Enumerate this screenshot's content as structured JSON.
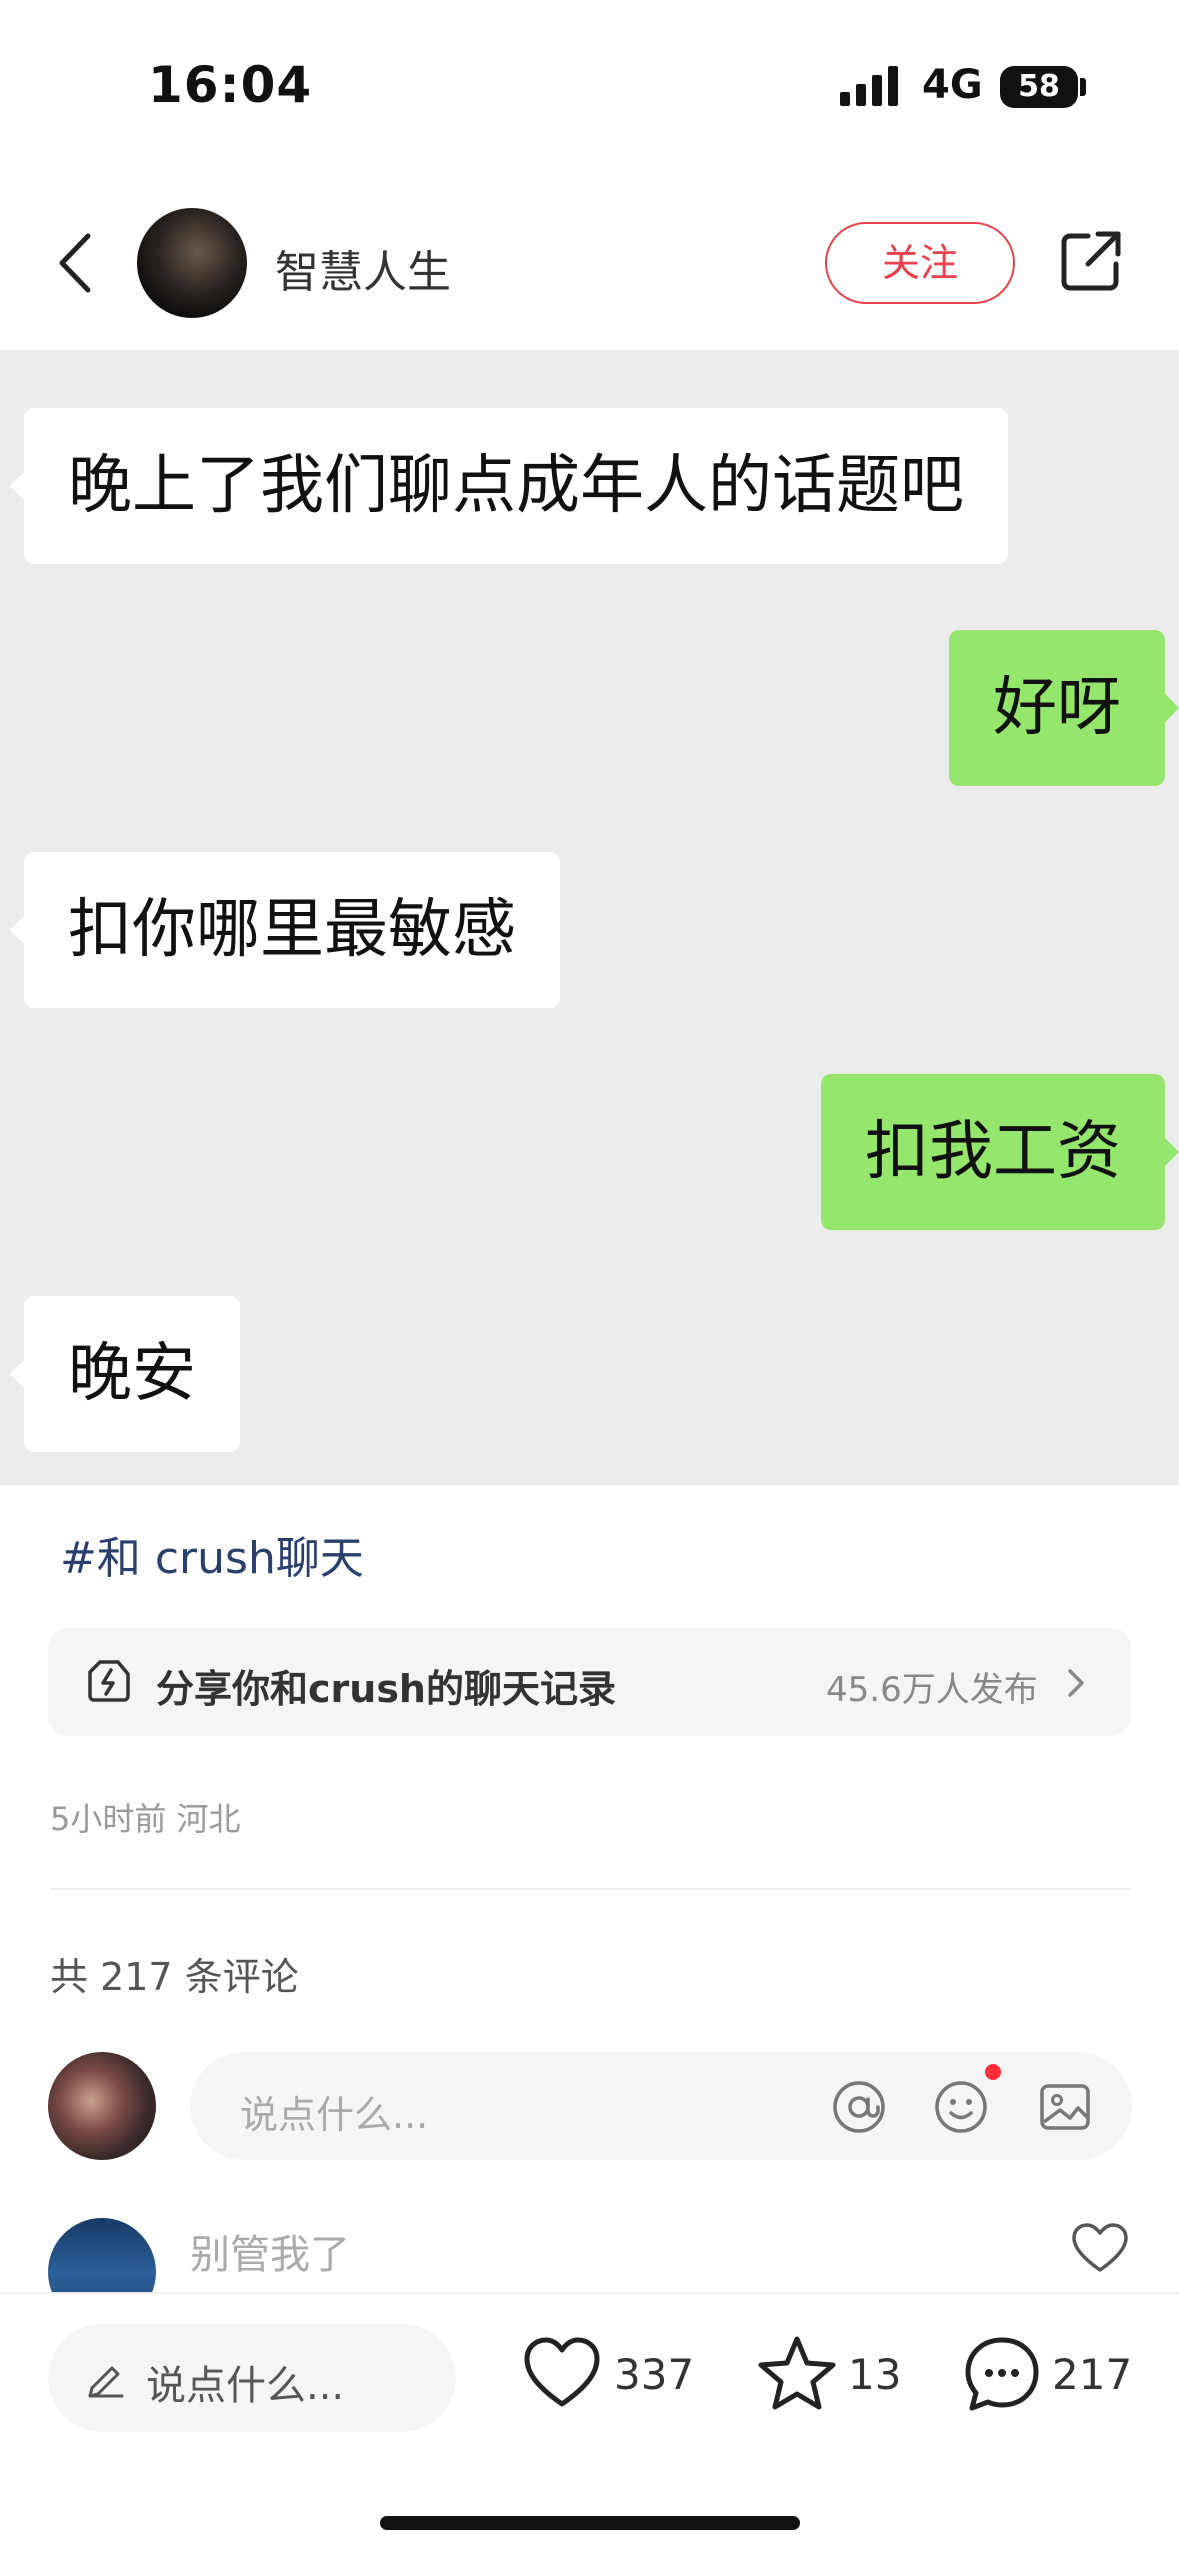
{
  "status_bar": {
    "time": "16:04",
    "network": "4G",
    "battery": "58"
  },
  "header": {
    "author": "智慧人生",
    "follow_label": "关注"
  },
  "chat": {
    "messages": [
      {
        "side": "left",
        "text": "晚上了我们聊点成年人的话题吧"
      },
      {
        "side": "right",
        "text": "好呀"
      },
      {
        "side": "left",
        "text": "扣你哪里最敏感"
      },
      {
        "side": "right",
        "text": "扣我工资"
      },
      {
        "side": "left",
        "text": "晚安"
      }
    ],
    "colors": {
      "background": "#ececec",
      "left_bubble": "#ffffff",
      "right_bubble": "#95e66c"
    }
  },
  "post": {
    "topic": "#和 crush聊天",
    "promo_text": "分享你和crush的聊天记录",
    "promo_count": "45.6万人发布",
    "meta": "5小时前 河北",
    "comment_count_text": "共 217 条评论"
  },
  "comment_box": {
    "placeholder": "说点什么..."
  },
  "comments": [
    {
      "text": "别管我了"
    }
  ],
  "bottom_bar": {
    "input_placeholder": "说点什么...",
    "likes": "337",
    "stars": "13",
    "comments": "217"
  },
  "icons": [
    "back-icon",
    "share-icon",
    "topic-spark-icon",
    "chevron-right-icon",
    "at-icon",
    "emoji-icon",
    "image-icon",
    "heart-icon",
    "pencil-icon",
    "star-icon",
    "chat-bubble-icon"
  ],
  "accent_color": "#e8414b"
}
